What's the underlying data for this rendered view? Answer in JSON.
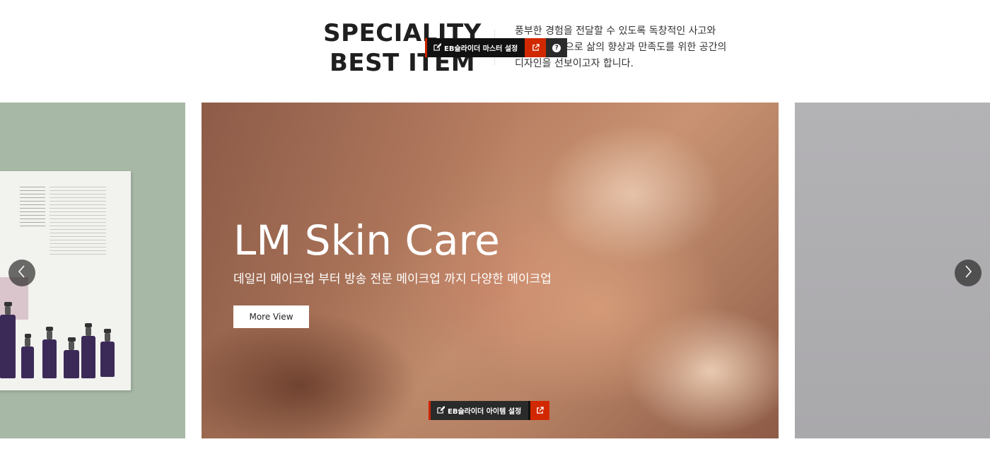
{
  "section": {
    "heading_line1": "SPECIALITY",
    "heading_line2": "BEST ITEM",
    "intro_line1": "풍부한 경험을 전달할 수 있도록 독창적인 사고와",
    "intro_line2": "으로 삶의 향상과 만족도를 위한 공간의",
    "intro_line3": "디자인을 선보이고자 합니다."
  },
  "admin": {
    "master_label": "EB슬라이더 마스터 설정",
    "help_glyph": "?",
    "item_label": "EB슬라이더 아이템 설정"
  },
  "slider": {
    "current_slide": {
      "title": "LM Skin Care",
      "subtitle": "데일리 메이크업 부터 방송 전문 메이크업 까지 다양한 메이크업",
      "button_label": "More View"
    }
  },
  "icons": {
    "edit": "edit-icon",
    "external": "external-link-icon",
    "help": "help-icon",
    "prev": "chevron-left-icon",
    "next": "chevron-right-icon"
  },
  "colors": {
    "admin_dark": "#111111",
    "admin_red": "#d22800",
    "heading": "#1f1f1f"
  }
}
